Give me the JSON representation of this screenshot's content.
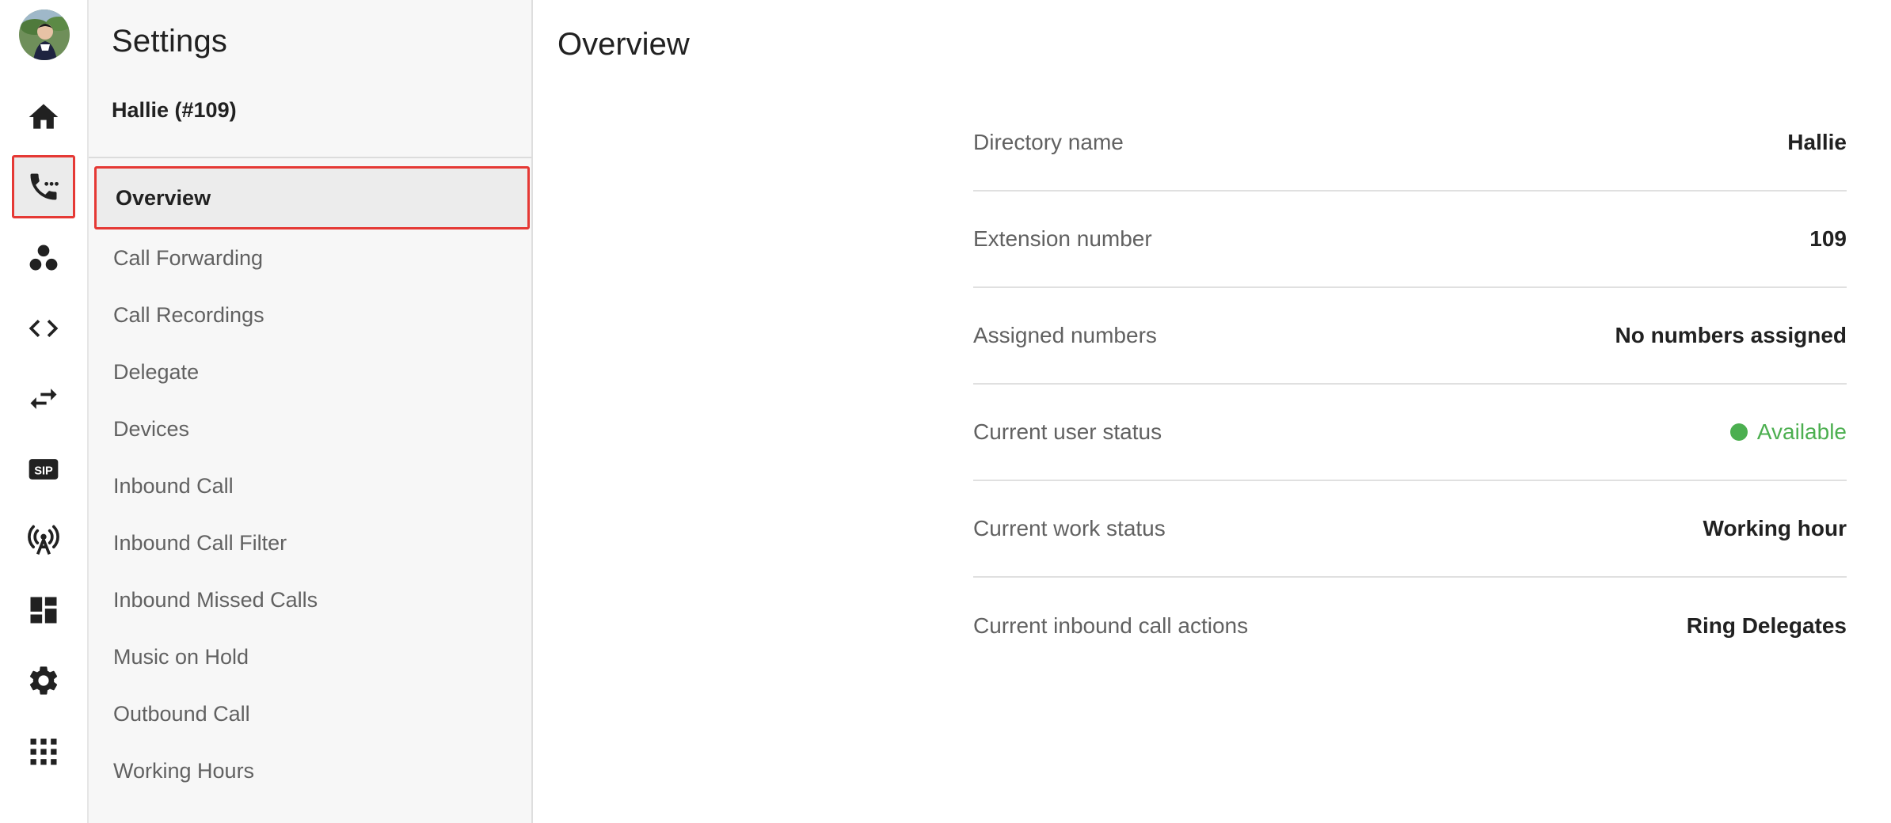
{
  "rail": {
    "items": [
      {
        "name": "home-icon"
      },
      {
        "name": "phone-call-icon",
        "active": true
      },
      {
        "name": "groups-icon"
      },
      {
        "name": "code-icon"
      },
      {
        "name": "swap-icon"
      },
      {
        "name": "sip-icon",
        "text": "SIP"
      },
      {
        "name": "antenna-icon"
      },
      {
        "name": "dashboard-icon"
      },
      {
        "name": "gear-icon"
      },
      {
        "name": "apps-grid-icon"
      }
    ]
  },
  "panel": {
    "title": "Settings",
    "user": "Hallie (#109)",
    "menu": [
      "Overview",
      "Call Forwarding",
      "Call Recordings",
      "Delegate",
      "Devices",
      "Inbound Call",
      "Inbound Call Filter",
      "Inbound Missed Calls",
      "Music on Hold",
      "Outbound Call",
      "Working Hours"
    ],
    "active_index": 0
  },
  "main": {
    "title": "Overview",
    "rows": [
      {
        "label": "Directory name",
        "value": "Hallie"
      },
      {
        "label": "Extension number",
        "value": "109"
      },
      {
        "label": "Assigned numbers",
        "value": "No numbers assigned"
      },
      {
        "label": "Current user status",
        "value": "Available"
      },
      {
        "label": "Current work status",
        "value": "Working hour"
      },
      {
        "label": "Current inbound call actions",
        "value": "Ring Delegates"
      }
    ]
  },
  "colors": {
    "accent_red": "#e53935",
    "status_green": "#4caf50"
  }
}
